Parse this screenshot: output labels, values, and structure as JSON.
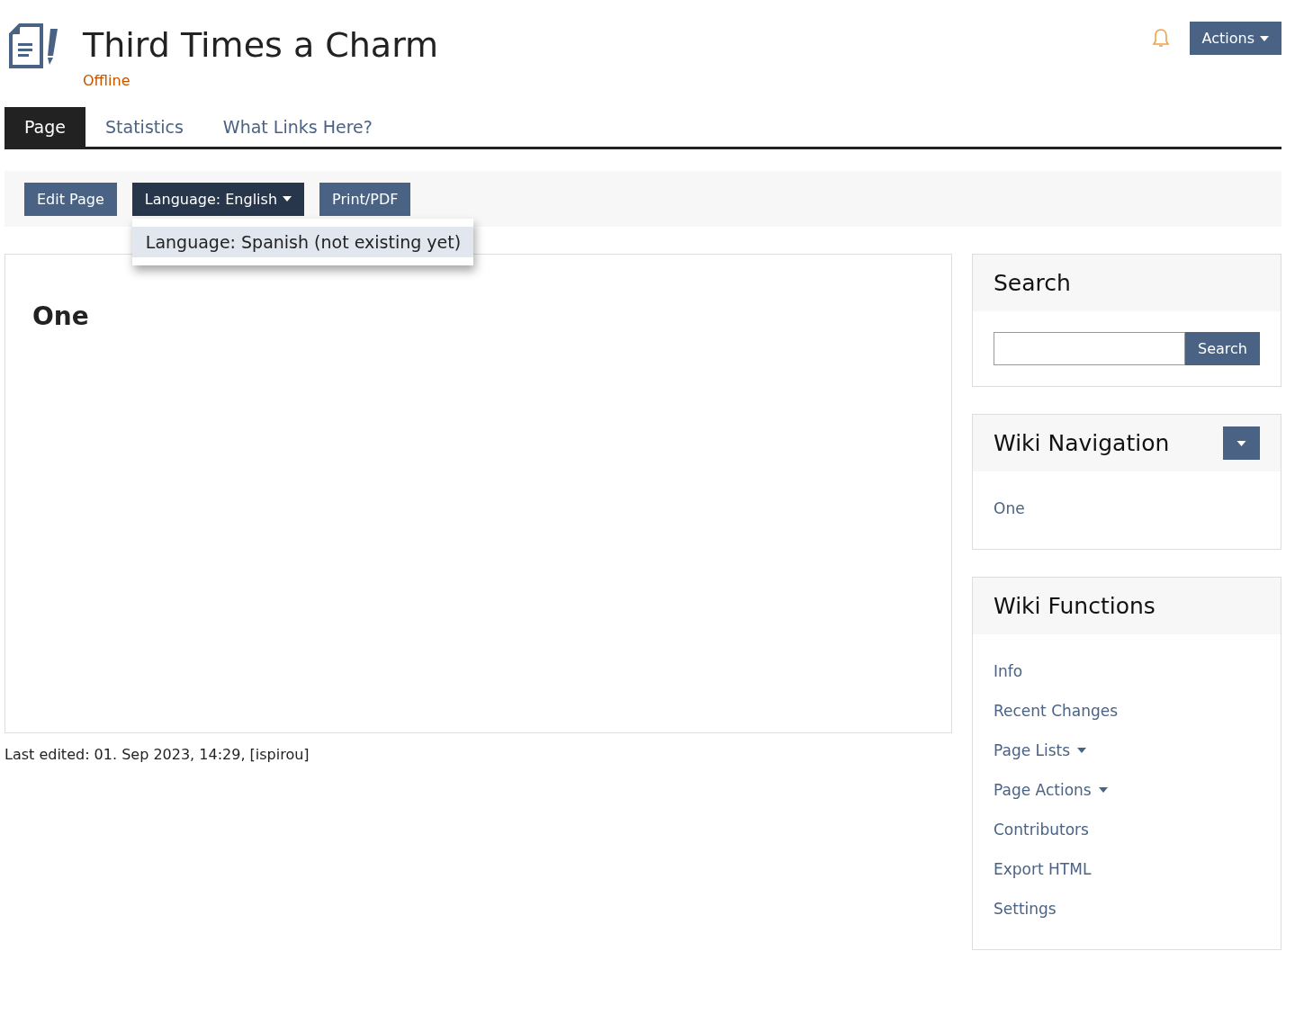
{
  "header": {
    "title": "Third Times a Charm",
    "status": "Offline",
    "actions_button": "Actions"
  },
  "tabs": [
    {
      "label": "Page",
      "selected": true
    },
    {
      "label": "Statistics",
      "selected": false
    },
    {
      "label": "What Links Here?",
      "selected": false
    }
  ],
  "toolbar": {
    "buttons": [
      {
        "label": "Edit Page",
        "kind": "button"
      },
      {
        "label": "Language: English",
        "kind": "dropdown",
        "open": true
      },
      {
        "label": "Print/PDF",
        "kind": "button"
      }
    ],
    "menu": [
      {
        "label": "Language: Spanish (not existing yet)",
        "selected": true
      }
    ]
  },
  "content": {
    "heading": "One"
  },
  "footer": "Last edited: 01. Sep 2023, 14:29, [ispirou]",
  "sidebar": {
    "search": {
      "title": "Search",
      "button": "Search"
    },
    "navigation": {
      "title": "Wiki Navigation",
      "items": [
        "One"
      ]
    },
    "functions": {
      "title": "Wiki Functions",
      "items": [
        {
          "label": "Info",
          "kind": "link"
        },
        {
          "label": "Recent Changes",
          "kind": "link"
        },
        {
          "label": "Page Lists",
          "kind": "menu"
        },
        {
          "label": "Page Actions",
          "kind": "menu"
        },
        {
          "label": "Contributors",
          "kind": "link"
        },
        {
          "label": "Export HTML",
          "kind": "link"
        },
        {
          "label": "Settings",
          "kind": "link"
        }
      ]
    }
  }
}
